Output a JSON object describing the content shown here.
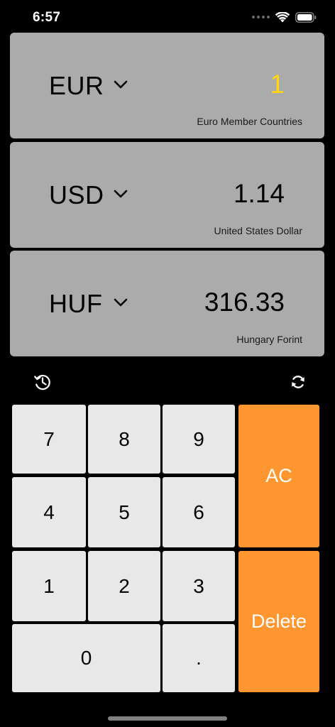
{
  "status_bar": {
    "time": "6:57",
    "icons": [
      "cellular-signal-icon",
      "wifi-icon",
      "battery-icon"
    ]
  },
  "converter": {
    "rows": [
      {
        "code": "EUR",
        "value": "1",
        "name": "Euro Member Countries",
        "active": true
      },
      {
        "code": "USD",
        "value": "1.14",
        "name": "United States Dollar",
        "active": false
      },
      {
        "code": "HUF",
        "value": "316.33",
        "name": "Hungary Forint",
        "active": false
      }
    ]
  },
  "tools": {
    "left_icon": "history-icon",
    "right_icon": "refresh-rates-icon"
  },
  "keypad": {
    "digits": [
      "7",
      "8",
      "9",
      "4",
      "5",
      "6",
      "1",
      "2",
      "3",
      "0",
      "."
    ],
    "clear_label": "AC",
    "delete_label": "Delete"
  },
  "colors": {
    "background": "#000000",
    "card": "#ababab",
    "active_value": "#ffd60a",
    "key": "#e8e8e8",
    "action_key": "#ff9630"
  }
}
